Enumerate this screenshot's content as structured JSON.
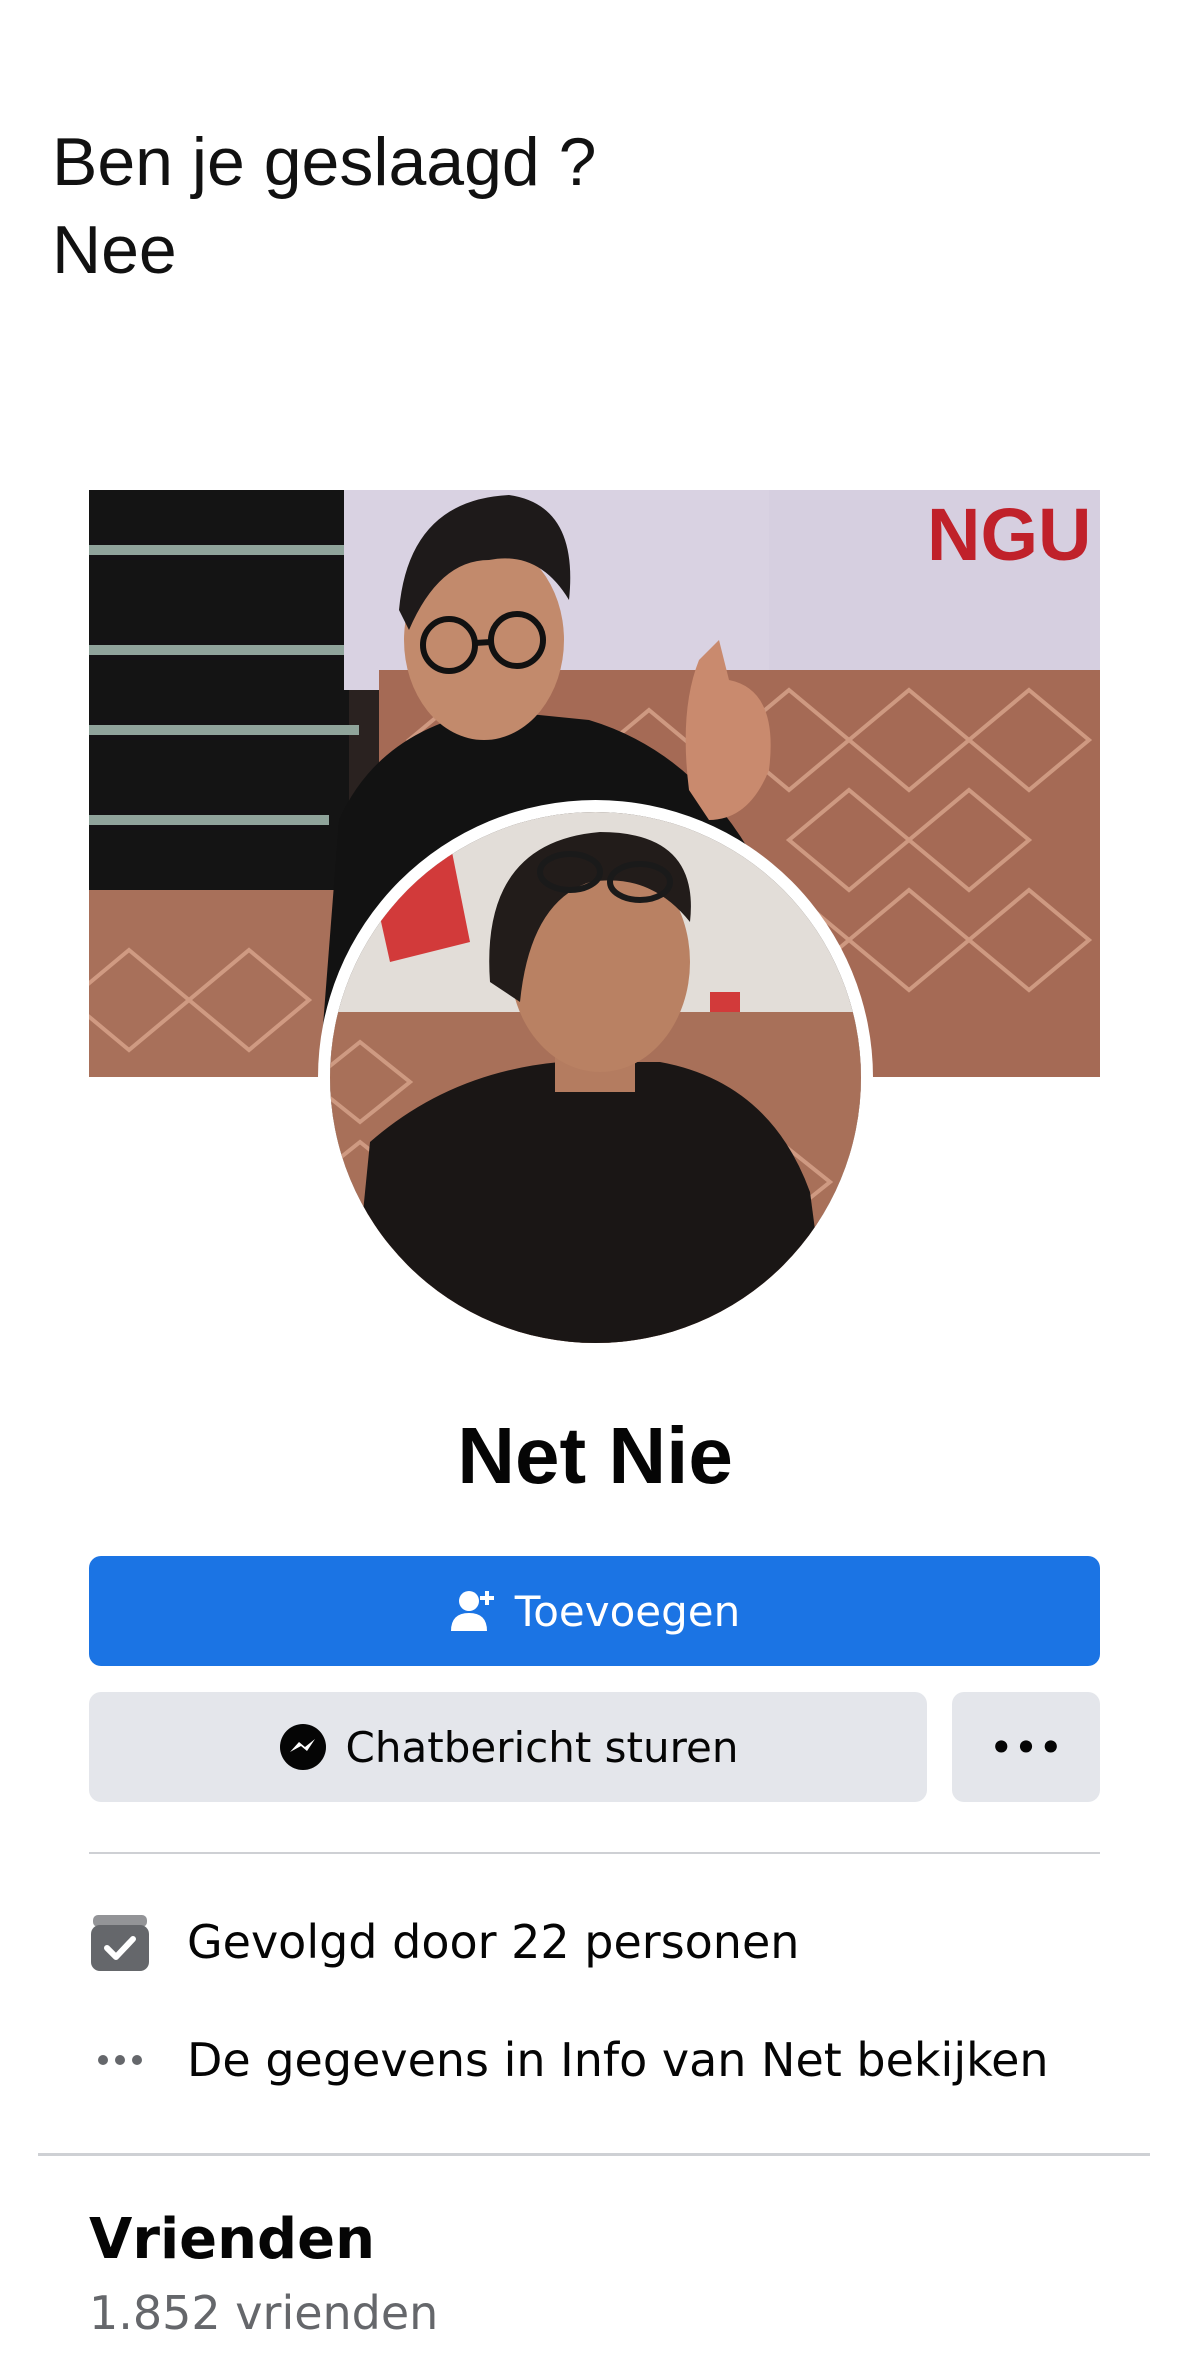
{
  "caption": {
    "question": "Ben je geslaagd ?",
    "answer": "Nee"
  },
  "cover_text_fragment": "NGU",
  "profile": {
    "name": "Net Nie"
  },
  "actions": {
    "add_label": "Toevoegen",
    "message_label": "Chatbericht sturen",
    "more_label": "•••"
  },
  "info": {
    "followed_by": "Gevolgd door 22 personen",
    "about": "De gegevens in Info van Net bekijken"
  },
  "friends": {
    "title": "Vrienden",
    "count": "1.852 vrienden"
  },
  "icons": {
    "add": "add-friend-icon",
    "message": "messenger-icon",
    "more": "more-dots-icon",
    "followed": "followed-badge-icon",
    "about": "info-dots-icon"
  },
  "colors": {
    "primary_button": "#1b74e4",
    "secondary_button": "#e4e6eb",
    "divider": "#ced0d4",
    "secondary_text": "#65676b"
  }
}
